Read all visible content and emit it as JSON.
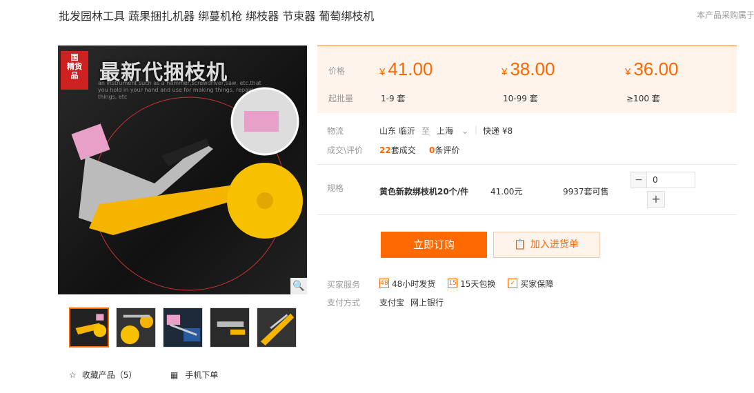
{
  "product": {
    "title": "批发园林工具 蔬果捆扎机器 绑蔓机枪 绑枝器 节束器 葡萄绑枝机",
    "side_note": "本产品采购属于"
  },
  "gallery": {
    "headline": "最新代捆枝机",
    "stamp": "国货精品",
    "subtitle": "an instrument such as a hammer,screwdriver,saw, etc.that you hold in your hand and use for making things, repairing things, etc",
    "zoom_icon": "magnifier-icon",
    "thumb_count": 5
  },
  "actions": {
    "favorite_label": "收藏产品（5）",
    "mobile_label": "手机下单"
  },
  "pricing": {
    "price_label": "价格",
    "moq_label": "起批量",
    "tiers": [
      {
        "price": "41.00",
        "range": "1-9 套"
      },
      {
        "price": "38.00",
        "range": "10-99 套"
      },
      {
        "price": "36.00",
        "range": "≥100 套"
      }
    ],
    "currency": "¥"
  },
  "logistics": {
    "label": "物流",
    "from": "山东 临沂",
    "to_word": "至",
    "to": "上海",
    "shipping": "快递 ¥8"
  },
  "deals": {
    "label": "成交\\评价",
    "sold_count": "22",
    "sold_suffix": "套成交",
    "review_count": "0",
    "review_suffix": "条评价"
  },
  "spec": {
    "label": "规格",
    "name": "黄色新款绑枝机20个/件",
    "price": "41.00元",
    "stock": "9937套可售",
    "quantity": "0",
    "minus": "−",
    "plus": "+"
  },
  "buttons": {
    "buy_now": "立即订购",
    "add_cart": "加入进货单"
  },
  "services": {
    "label": "买家服务",
    "items": [
      "48小时发货",
      "15天包换",
      "买家保障"
    ],
    "pay_label": "支付方式",
    "pay_methods": [
      "支付宝",
      "网上银行"
    ]
  },
  "colors": {
    "accent": "#ff6a00",
    "price_bg": "#fff4ec"
  }
}
